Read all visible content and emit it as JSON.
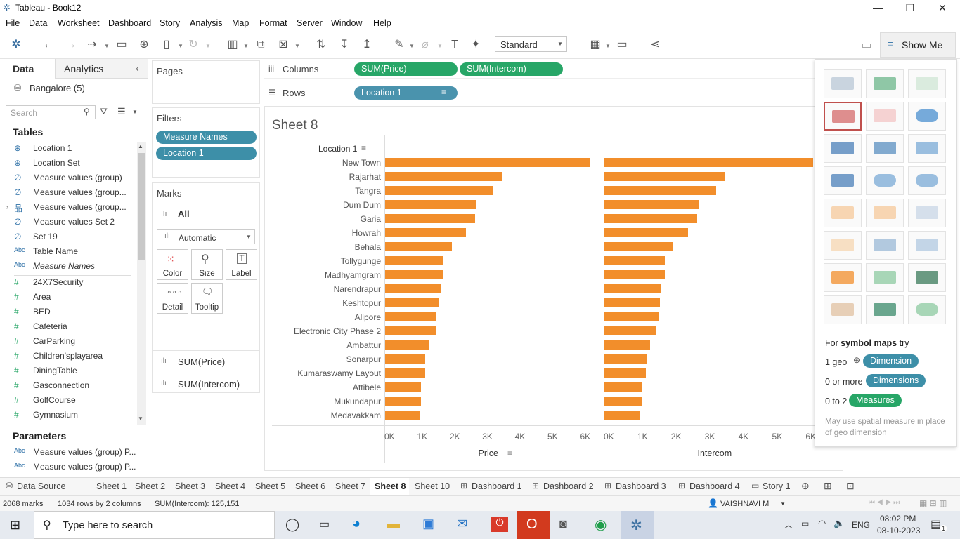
{
  "window": {
    "title": "Tableau - Book12",
    "minimize": "—",
    "restore": "❐",
    "close": "✕"
  },
  "menu": [
    "File",
    "Data",
    "Worksheet",
    "Dashboard",
    "Story",
    "Analysis",
    "Map",
    "Format",
    "Server",
    "Window",
    "Help"
  ],
  "toolbar": {
    "fit": "Standard",
    "show_me": "Show Me"
  },
  "data_pane": {
    "tab_data": "Data",
    "tab_analytics": "Analytics",
    "datasource": "Bangalore (5)",
    "search_placeholder": "Search",
    "tables_label": "Tables",
    "fields": [
      {
        "icon": "⊕",
        "name": "Location 1",
        "italic": false,
        "color": "#2c6fa6"
      },
      {
        "icon": "⊕",
        "name": "Location Set",
        "italic": false,
        "color": "#2c6fa6"
      },
      {
        "icon": "∅",
        "name": "Measure values (group)",
        "italic": false,
        "color": "#2c6fa6"
      },
      {
        "icon": "∅",
        "name": "Measure values (group...",
        "italic": false,
        "color": "#2c6fa6"
      },
      {
        "icon": "品",
        "name": "Measure values (group...",
        "italic": false,
        "color": "#2c6fa6"
      },
      {
        "icon": "∅",
        "name": "Measure values Set 2",
        "italic": false,
        "color": "#2c6fa6"
      },
      {
        "icon": "∅",
        "name": "Set 19",
        "italic": false,
        "color": "#2c6fa6"
      },
      {
        "icon": "Abc",
        "name": "Table Name",
        "italic": false,
        "color": "#2c6fa6"
      },
      {
        "icon": "Abc",
        "name": "Measure Names",
        "italic": true,
        "color": "#2c6fa6"
      },
      {
        "icon": "#",
        "name": "24X7Security",
        "italic": false,
        "color": "#27a667"
      },
      {
        "icon": "#",
        "name": "Area",
        "italic": false,
        "color": "#27a667"
      },
      {
        "icon": "#",
        "name": "BED",
        "italic": false,
        "color": "#27a667"
      },
      {
        "icon": "#",
        "name": "Cafeteria",
        "italic": false,
        "color": "#27a667"
      },
      {
        "icon": "#",
        "name": "CarParking",
        "italic": false,
        "color": "#27a667"
      },
      {
        "icon": "#",
        "name": "Children'splayarea",
        "italic": false,
        "color": "#27a667"
      },
      {
        "icon": "#",
        "name": "DiningTable",
        "italic": false,
        "color": "#27a667"
      },
      {
        "icon": "#",
        "name": "Gasconnection",
        "italic": false,
        "color": "#27a667"
      },
      {
        "icon": "#",
        "name": "GolfCourse",
        "italic": false,
        "color": "#27a667"
      },
      {
        "icon": "#",
        "name": "Gymnasium",
        "italic": false,
        "color": "#27a667"
      }
    ],
    "parameters_label": "Parameters",
    "parameters": [
      "Measure values (group) P...",
      "Measure values (group) P..."
    ]
  },
  "pages": {
    "title": "Pages"
  },
  "filters": {
    "title": "Filters",
    "pills": [
      "Measure Names",
      "Location 1"
    ]
  },
  "marks": {
    "title": "Marks",
    "all": "All",
    "type": "Automatic",
    "buttons": [
      "Color",
      "Size",
      "Label",
      "Detail",
      "Tooltip"
    ],
    "measures": [
      "SUM(Price)",
      "SUM(Intercom)"
    ]
  },
  "shelves": {
    "columns_label": "Columns",
    "rows_label": "Rows",
    "columns": [
      "SUM(Price)",
      "SUM(Intercom)"
    ],
    "rows": [
      "Location 1"
    ]
  },
  "sheet": {
    "title": "Sheet 8",
    "row_header": "Location 1"
  },
  "chart_data": {
    "type": "bar",
    "categories": [
      "New Town",
      "Rajarhat",
      "Tangra",
      "Dum Dum",
      "Garia",
      "Howrah",
      "Behala",
      "Tollygunge",
      "Madhyamgram",
      "Narendrapur",
      "Keshtopur",
      "Alipore",
      "Electronic City Phase 2",
      "Ambattur",
      "Sonarpur",
      "Kumaraswamy Layout",
      "Attibele",
      "Mukundapur",
      "Medavakkam"
    ],
    "series": [
      {
        "name": "Price",
        "values": [
          6300,
          3570,
          3320,
          2800,
          2750,
          2470,
          2050,
          1790,
          1790,
          1700,
          1650,
          1580,
          1550,
          1350,
          1230,
          1220,
          1100,
          1100,
          1070
        ],
        "xlim": [
          0,
          6400
        ],
        "ticks": [
          "0K",
          "1K",
          "2K",
          "3K",
          "4K",
          "5K",
          "6K"
        ],
        "label": "Price"
      },
      {
        "name": "Intercom",
        "values": [
          6300,
          3580,
          3310,
          2800,
          2760,
          2480,
          2050,
          1800,
          1800,
          1700,
          1650,
          1600,
          1550,
          1350,
          1250,
          1230,
          1100,
          1100,
          1050
        ],
        "xlim": [
          0,
          6200
        ],
        "ticks": [
          "0K",
          "1K",
          "2K",
          "3K",
          "4K",
          "5K",
          "6K"
        ],
        "label": "Intercom"
      }
    ],
    "bar_color": "#f28e2b"
  },
  "show_me": {
    "hint_prefix": "For ",
    "hint_bold": "symbol maps",
    "hint_suffix": " try",
    "req": [
      {
        "k": "1 geo",
        "v": "Dimension"
      },
      {
        "k": "0 or more",
        "v": "Dimensions"
      },
      {
        "k": "0 to 2",
        "v": "Measures"
      }
    ],
    "note": "May use spatial measure in place of geo dimension"
  },
  "tabs": [
    "Data Source",
    "Sheet 1",
    "Sheet 2",
    "Sheet 3",
    "Sheet 4",
    "Sheet 5",
    "Sheet 6",
    "Sheet 7",
    "Sheet 8",
    "Sheet 10",
    "Dashboard 1",
    "Dashboard 2",
    "Dashboard 3",
    "Dashboard 4",
    "Story 1"
  ],
  "status": {
    "marks": "2068 marks",
    "rows": "1034 rows by 2 columns",
    "sum": "SUM(Intercom): 125,151",
    "user": "VAISHNAVI M"
  },
  "taskbar": {
    "search": "Type here to search",
    "lang": "ENG",
    "time": "08:02 PM",
    "date": "08-10-2023",
    "notif": "1"
  }
}
